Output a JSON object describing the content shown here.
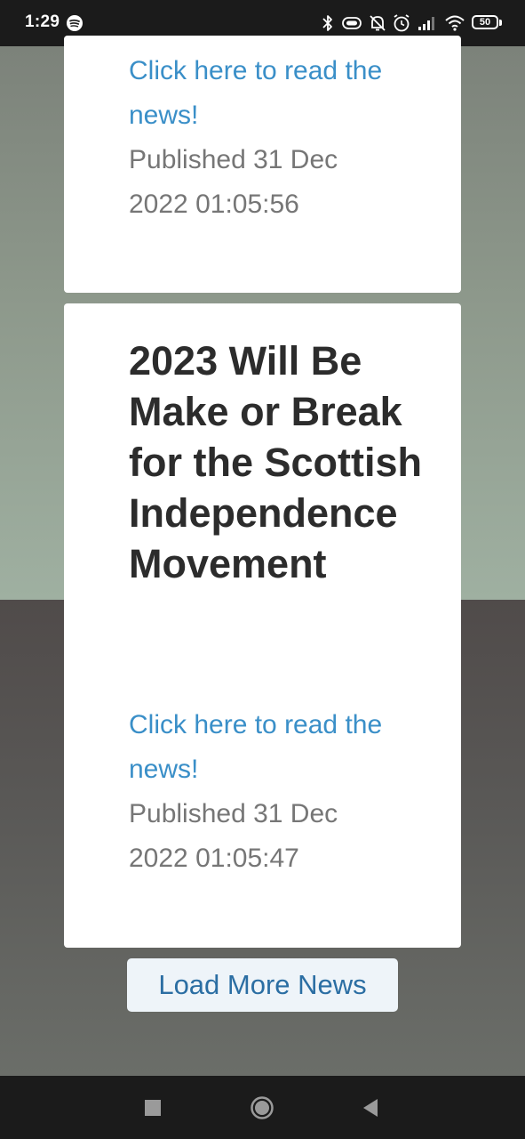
{
  "status_bar": {
    "time": "1:29",
    "battery_level": "50",
    "icons": [
      "spotify-icon",
      "bluetooth-icon",
      "vibrate-icon",
      "bell-off-icon",
      "alarm-icon",
      "signal-icon",
      "wifi-icon",
      "battery-icon"
    ]
  },
  "cards": [
    {
      "link_text": "Click here to read the news!",
      "published": "Published 31 Dec 2022 01:05:56"
    },
    {
      "headline": "2023 Will Be Make or Break for the Scottish Independence Movement",
      "link_text": "Click here to read the news!",
      "published": "Published 31 Dec 2022 01:05:47"
    }
  ],
  "load_more_label": "Load More News",
  "nav_bar": {
    "icons": [
      "recents-icon",
      "home-icon",
      "back-icon"
    ]
  },
  "colors": {
    "link": "#3a8fc8",
    "button_text": "#2b6ea3",
    "button_bg": "#eef4f9"
  }
}
